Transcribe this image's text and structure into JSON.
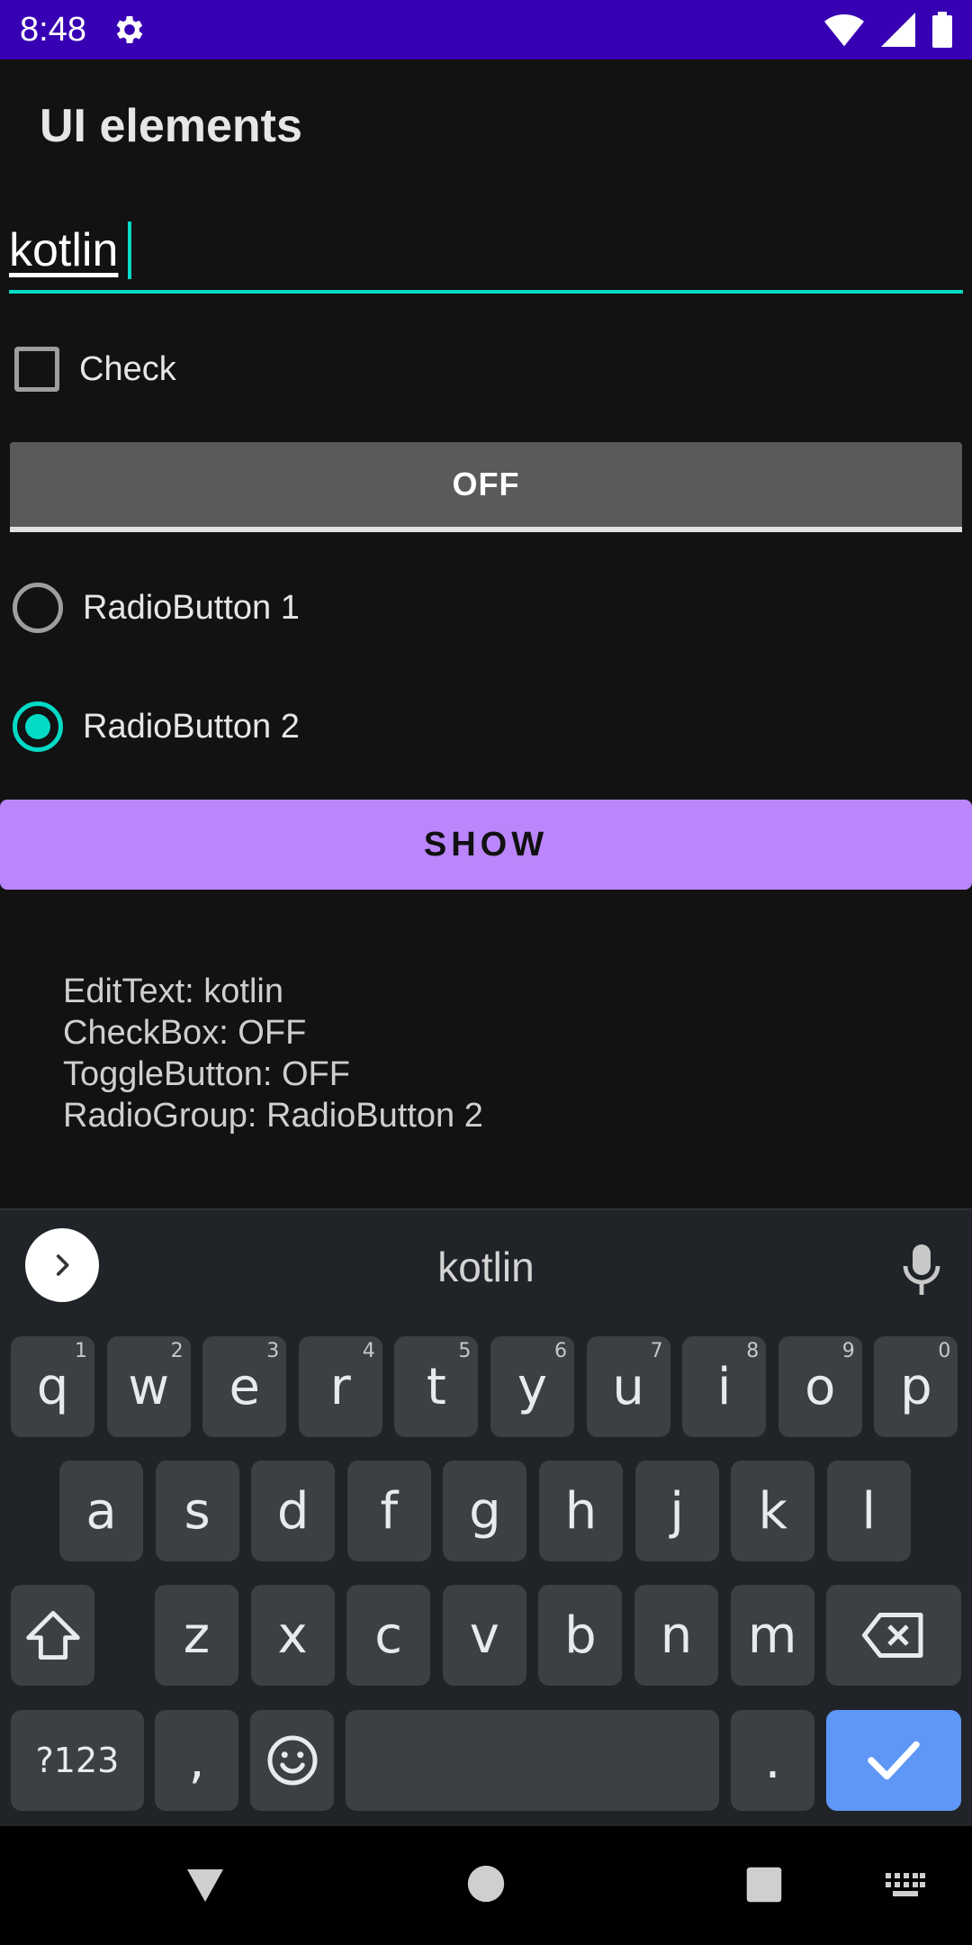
{
  "status_bar": {
    "time": "8:48",
    "icons": [
      "settings-icon",
      "wifi-icon",
      "signal-icon",
      "battery-icon"
    ]
  },
  "app": {
    "title": "UI elements"
  },
  "edit_text": {
    "value": "kotlin"
  },
  "checkbox": {
    "label": "Check",
    "checked": false
  },
  "toggle": {
    "label": "OFF"
  },
  "radios": [
    {
      "label": "RadioButton 1",
      "checked": false
    },
    {
      "label": "RadioButton 2",
      "checked": true
    }
  ],
  "show_button": {
    "label": "SHOW"
  },
  "output": {
    "line1": "EditText: kotlin",
    "line2": "CheckBox: OFF",
    "line3": "ToggleButton: OFF",
    "line4": "RadioGroup: RadioButton 2"
  },
  "keyboard": {
    "suggestion": "kotlin",
    "row1": [
      {
        "k": "q",
        "h": "1"
      },
      {
        "k": "w",
        "h": "2"
      },
      {
        "k": "e",
        "h": "3"
      },
      {
        "k": "r",
        "h": "4"
      },
      {
        "k": "t",
        "h": "5"
      },
      {
        "k": "y",
        "h": "6"
      },
      {
        "k": "u",
        "h": "7"
      },
      {
        "k": "i",
        "h": "8"
      },
      {
        "k": "o",
        "h": "9"
      },
      {
        "k": "p",
        "h": "0"
      }
    ],
    "row2": [
      "a",
      "s",
      "d",
      "f",
      "g",
      "h",
      "j",
      "k",
      "l"
    ],
    "row3": [
      "z",
      "x",
      "c",
      "v",
      "b",
      "n",
      "m"
    ],
    "symbols_key": "?123",
    "comma_key": ",",
    "period_key": "."
  },
  "colors": {
    "accent": "#03dac5",
    "primary": "#bb86fc",
    "status_bar": "#3700b3",
    "enter_key": "#5e97f6"
  }
}
